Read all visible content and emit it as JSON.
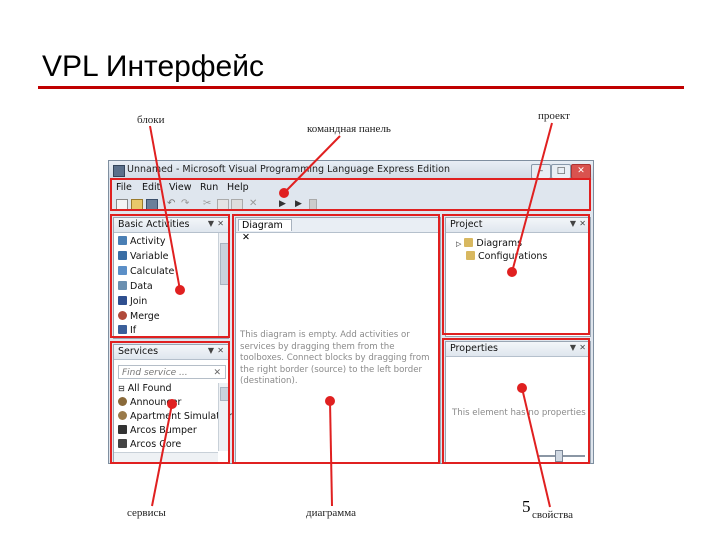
{
  "slide": {
    "title": "VPL Интерфейс",
    "page_number": "5"
  },
  "annotations": {
    "blocks": "блоки",
    "command_panel": "командная панель",
    "project": "проект",
    "services": "сервисы",
    "diagram": "диаграмма",
    "properties": "свойства"
  },
  "window": {
    "title": "Unnamed - Microsoft Visual Programming Language  Express Edition",
    "controls": [
      "–",
      "□",
      "✕"
    ]
  },
  "menu": [
    "File",
    "Edit",
    "View",
    "Run",
    "Help"
  ],
  "toolbar_icons": [
    "new-icon",
    "open-icon",
    "save-icon",
    "undo-icon",
    "redo-icon",
    "cut-icon",
    "copy-icon",
    "paste-icon",
    "delete-icon",
    "run-icon",
    "debug-icon"
  ],
  "basic_activities": {
    "title": "Basic Activities",
    "items": [
      {
        "label": "Activity",
        "color": "#4a7fb5"
      },
      {
        "label": "Variable",
        "color": "#3a6ea5"
      },
      {
        "label": "Calculate",
        "color": "#5b8fc7"
      },
      {
        "label": "Data",
        "color": "#6a8fb0"
      },
      {
        "label": "Join",
        "color": "#2f4f8f"
      },
      {
        "label": "Merge",
        "color": "#b04a3a"
      },
      {
        "label": "If",
        "color": "#3b5f9a"
      }
    ]
  },
  "services": {
    "title": "Services",
    "search_placeholder": "Find service ...",
    "group": "All Found",
    "items": [
      {
        "label": "Announcer",
        "color": "#8a6a3a"
      },
      {
        "label": "Apartment Simulation",
        "color": "#9a7a4a"
      },
      {
        "label": "Arcos Bumper",
        "color": "#333333"
      },
      {
        "label": "Arcos Core",
        "color": "#444444"
      }
    ]
  },
  "diagram": {
    "tab": "Diagram",
    "empty_message": "This diagram is empty. Add activities or services by dragging them from the toolboxes. Connect blocks by dragging from the right border (source) to the left border (destination)."
  },
  "project": {
    "title": "Project",
    "items": [
      "Diagrams",
      "Configurations"
    ]
  },
  "properties": {
    "title": "Properties",
    "empty_message": "This element has no properties"
  },
  "colors": {
    "highlight": "#e02020",
    "title_rule": "#c00000"
  }
}
